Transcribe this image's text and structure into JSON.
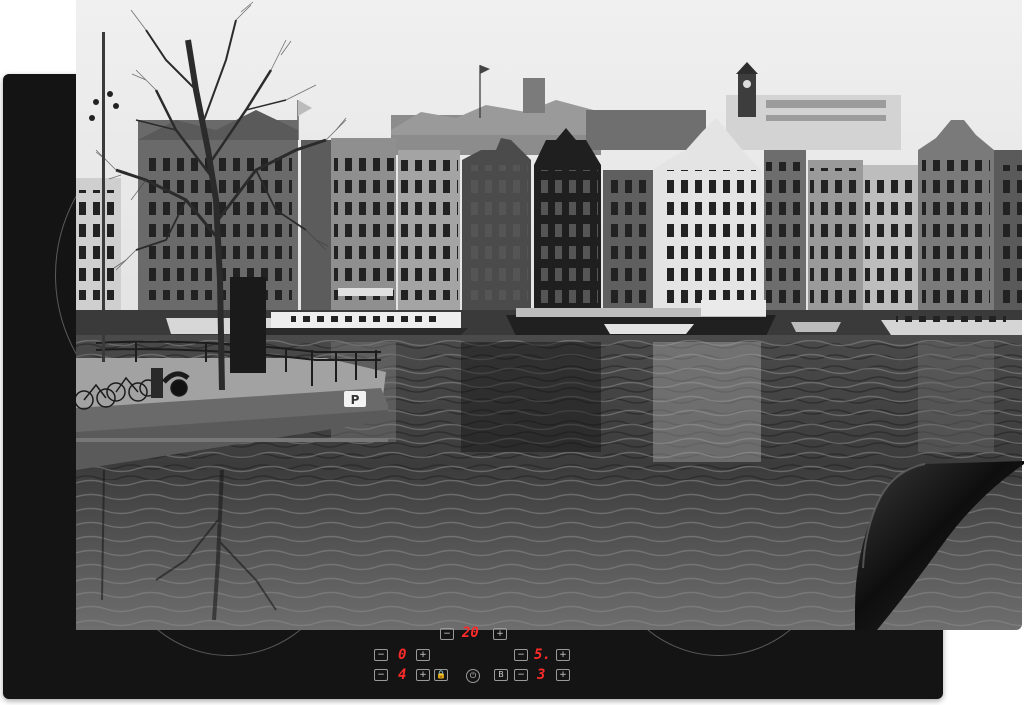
{
  "scene": {
    "parking_sign": "P",
    "theme_colors": {
      "sky": "#e9e9e9",
      "water": "#3a3a3a",
      "cooktop": "#141414",
      "display_digits": "#ff2b2b",
      "mat_back": "#0c0c0c"
    }
  },
  "cooktop_controls": {
    "timer_display": "20",
    "left_zone_display_top": "0",
    "left_zone_display_bottom": "4",
    "right_zone_display_top": "5.",
    "right_zone_display_bottom": "3",
    "minus_label": "−",
    "plus_label": "+",
    "boost_label": "B",
    "icons": [
      "lock-icon",
      "power-icon"
    ]
  }
}
